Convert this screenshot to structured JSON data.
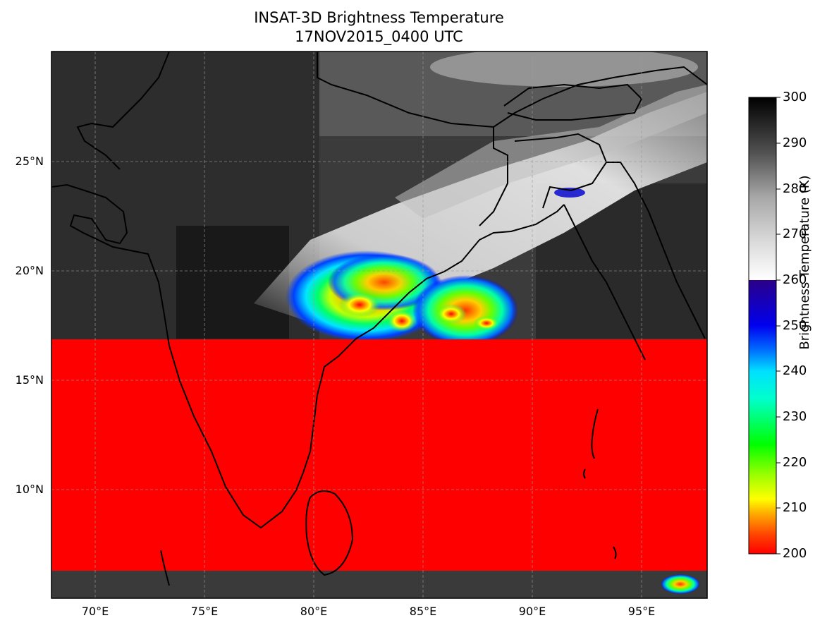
{
  "figure": {
    "title_line1": "INSAT-3D Brightness Temperature",
    "title_line2": "17NOV2015_0400 UTC"
  },
  "map": {
    "lon_range": [
      68,
      98
    ],
    "lat_range": [
      4.8,
      29.8
    ],
    "lon_ticks": [
      {
        "value": 70,
        "label": "70°E"
      },
      {
        "value": 75,
        "label": "75°E"
      },
      {
        "value": 80,
        "label": "80°E"
      },
      {
        "value": 85,
        "label": "85°E"
      },
      {
        "value": 90,
        "label": "90°E"
      },
      {
        "value": 95,
        "label": "95°E"
      }
    ],
    "lat_ticks": [
      {
        "value": 25,
        "label": "25°N"
      },
      {
        "value": 20,
        "label": "20°N"
      },
      {
        "value": 15,
        "label": "15°N"
      },
      {
        "value": 10,
        "label": "10°N"
      }
    ],
    "gridlines": true,
    "missing_band_lat": [
      6.2,
      16.8
    ]
  },
  "colorbar": {
    "label": "Brightness Temperature (K)",
    "min": 200,
    "max": 300,
    "ticks": [
      "300",
      "290",
      "280",
      "270",
      "260",
      "250",
      "240",
      "230",
      "220",
      "210",
      "200"
    ],
    "colors": {
      "200": "#ff0000",
      "210": "#ffff00",
      "220": "#00ff00",
      "230": "#00ffff",
      "240": "#0000ff",
      "250": "#2b0088",
      "260": "#ffffff",
      "300": "#000000"
    }
  }
}
